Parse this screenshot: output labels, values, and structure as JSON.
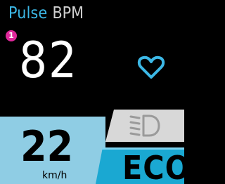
{
  "header": {
    "title": "Pulse",
    "unit": "BPM"
  },
  "notification": {
    "count": "1"
  },
  "heart_rate": {
    "value": "82"
  },
  "speed": {
    "value": "22",
    "unit": "km/h"
  },
  "mode": {
    "label": "ECO"
  },
  "icons": {
    "heart": "heart-icon",
    "headlight": "headlight-icon"
  },
  "colors": {
    "accent": "#3cb8e6",
    "badge": "#e0289b",
    "speed_panel": "#8fcde4",
    "eco_panel": "#1aa8d2",
    "light_panel": "#d8d8d8"
  }
}
